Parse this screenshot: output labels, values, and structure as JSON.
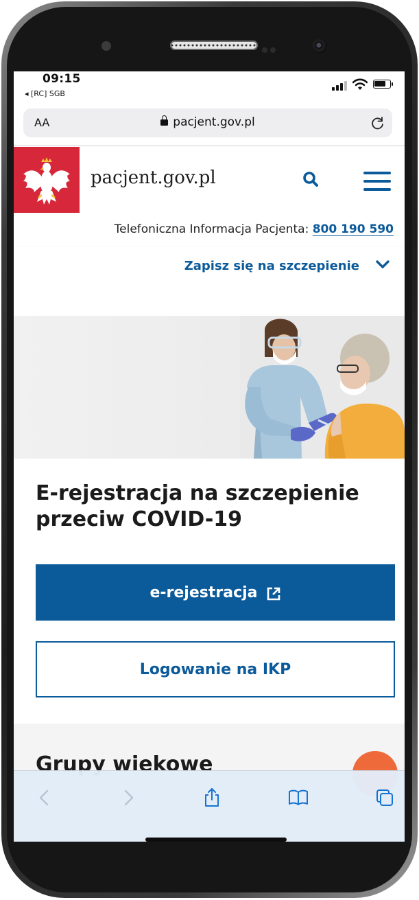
{
  "status_bar": {
    "time": "09:15",
    "carrier": "◂ [RC] SGB"
  },
  "address_bar": {
    "text_size_label": "AA",
    "url": "pacjent.gov.pl"
  },
  "site_header": {
    "site_name": "pacjent.gov.pl",
    "emblem": "white-eagle-emblem",
    "accent": "#d6283a"
  },
  "phone_info": {
    "label": "Telefoniczna Informacja Pacjenta: ",
    "number": "800 190 590"
  },
  "vaccination_menu": {
    "label": "Zapisz się na szczepienie"
  },
  "main": {
    "headline": "E-rejestracja na szczepienie przeciw COVID-19",
    "primary_button": "e-rejestracja",
    "secondary_button": "Logowanie na IKP",
    "section_title": "Grupy wiekowe"
  },
  "toolbar": {
    "items": [
      "back-icon",
      "forward-icon",
      "share-icon",
      "bookmarks-icon",
      "tabs-icon"
    ]
  },
  "colors": {
    "brand_blue": "#0b5a9a",
    "brand_red": "#d6283a",
    "fab_orange": "#ee6a3b"
  }
}
